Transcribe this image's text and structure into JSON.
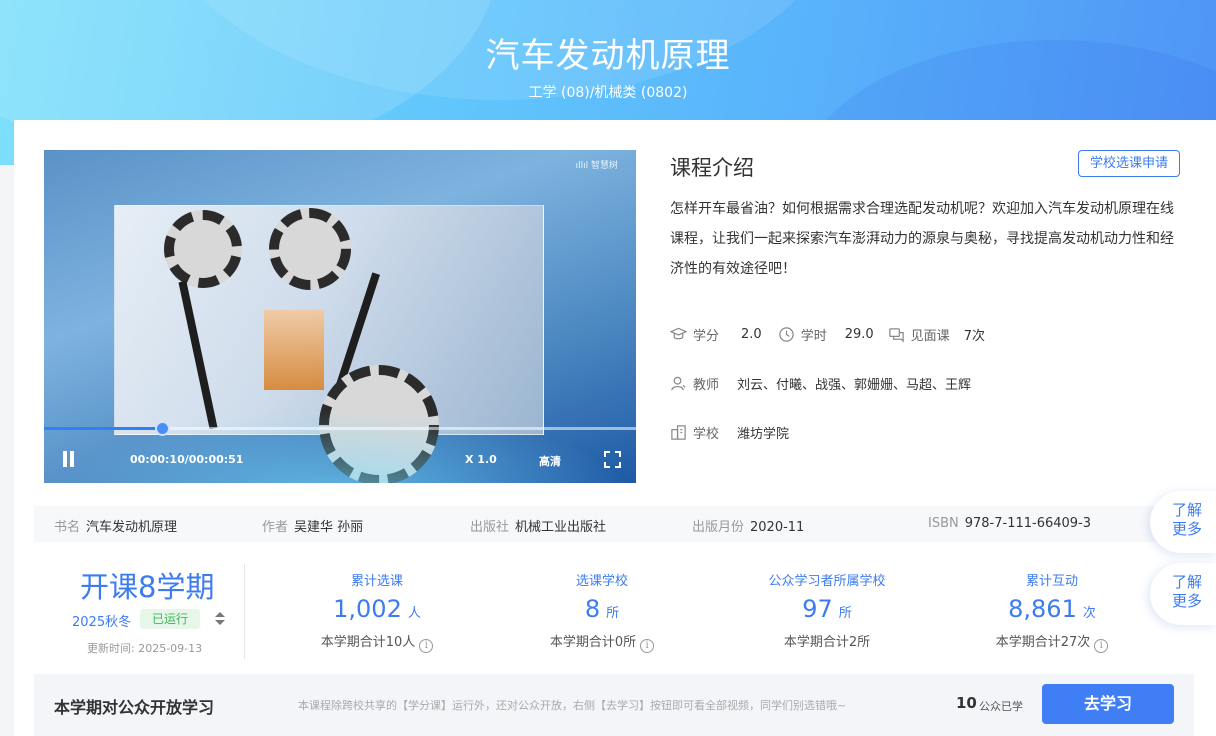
{
  "header": {
    "title": "汽车发动机原理",
    "subtitle": "工学 (08)/机械类 (0802)"
  },
  "video": {
    "watermark": "ıllıl 智慧树",
    "progress": 0.2,
    "time": "00:00:10/00:00:51",
    "speed": "X 1.0",
    "quality": "高清"
  },
  "intro": {
    "title": "课程介绍",
    "apply_button": "学校选课申请",
    "description": "怎样开车最省油？如何根据需求合理选配发动机呢？欢迎加入汽车发动机原理在线课程，让我们一起来探索汽车澎湃动力的源泉与奥秘，寻找提高发动机动力性和经济性的有效途径吧！"
  },
  "meta": {
    "credit_label": "学分",
    "credit_value": "2.0",
    "hours_label": "学时",
    "hours_value": "29.0",
    "meetings_label": "见面课",
    "meetings_value": "7次",
    "teachers_label": "教师",
    "teachers_value": "刘云、付曦、战强、郭姗姗、马超、王辉",
    "school_label": "学校",
    "school_value": "潍坊学院"
  },
  "book": {
    "name_label": "书名",
    "name_value": "汽车发动机原理",
    "author_label": "作者",
    "author_value": "吴建华 孙丽",
    "publisher_label": "出版社",
    "publisher_value": "机械工业出版社",
    "date_label": "出版月份",
    "date_value": "2020-11",
    "isbn_label": "ISBN",
    "isbn_value": "978-7-111-66409-3"
  },
  "side": {
    "learn_more_1": "了解更多",
    "learn_more_2": "了解更多"
  },
  "semester": {
    "headline": "开课8学期",
    "term": "2025秋冬",
    "status": "已运行",
    "updated": "更新时间:   2025-09-13"
  },
  "stats": [
    {
      "label": "累计选课",
      "value": "1,002",
      "unit": "人",
      "sub": "本学期合计10人"
    },
    {
      "label": "选课学校",
      "value": "8",
      "unit": "所",
      "sub": "本学期合计0所"
    },
    {
      "label": "公众学习者所属学校",
      "value": "97",
      "unit": "所",
      "sub": "本学期合计2所"
    },
    {
      "label": "累计互动",
      "value": "8,861",
      "unit": "次",
      "sub": "本学期合计27次"
    }
  ],
  "public": {
    "title": "本学期对公众开放学习",
    "note": "本课程除跨校共享的【学分课】运行外，还对公众开放，右侧【去学习】按钮即可看全部视频，同学们别选错哦~",
    "count": "10",
    "count_label": "公众已学",
    "button": "去学习"
  },
  "colors": {
    "accent": "#3d7cf0",
    "status_green": "#3eb55a",
    "hero_start": "#7fe0fb",
    "hero_end": "#4f94f5"
  }
}
